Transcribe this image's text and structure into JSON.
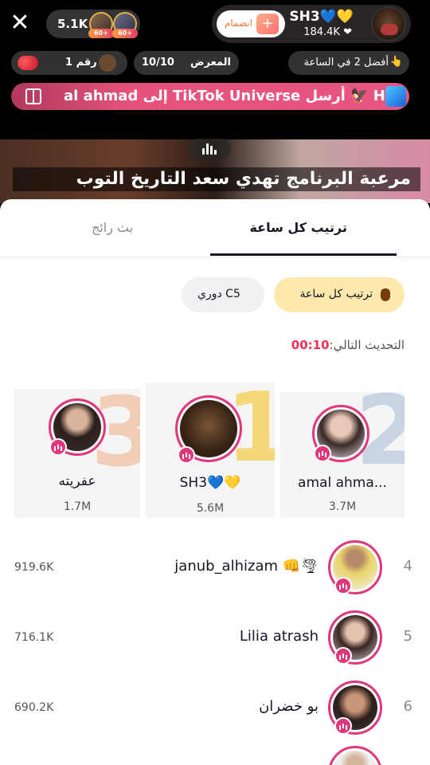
{
  "header": {
    "viewers": "5.1K",
    "viewer_badges": [
      "60+",
      "60+"
    ],
    "join_label": "انضمام",
    "host_name": "SH3💙💛",
    "host_likes": "184.4K ❤",
    "rank_label": "رقم 1",
    "gallery_label": "المعرض",
    "gallery_count": "10/10",
    "hourly_label": "أفضل 2 في الساعة"
  },
  "banner": {
    "text": "al ahmad إلى TikTok Universe أرسل 🦅 H"
  },
  "video": {
    "caption": "مرعبة البرنامج تهدي سعد التاريخ التوب"
  },
  "sheet": {
    "tabs": [
      {
        "label": "ترتيب كل ساعة",
        "active": true
      },
      {
        "label": "بث رائج",
        "active": false
      }
    ],
    "chips": [
      {
        "label": "ترتيب كل ساعة",
        "active": true
      },
      {
        "label": "دوري C5",
        "active": false
      }
    ],
    "next_update_label": "التحديث التالي:",
    "next_update_timer": "00:10",
    "podium": [
      {
        "rank": "2",
        "name": "amal ahma...",
        "score": "3.7M"
      },
      {
        "rank": "1",
        "name": "SH3💙💛",
        "score": "5.6M"
      },
      {
        "rank": "3",
        "name": "عفريته",
        "score": "1.7M"
      }
    ],
    "list": [
      {
        "rank": "4",
        "name": "janub_alhizam 👊🌪",
        "score": "919.6K"
      },
      {
        "rank": "5",
        "name": "Lilia atrash",
        "score": "716.1K"
      },
      {
        "rank": "6",
        "name": "بو خضران",
        "score": "690.2K"
      }
    ]
  },
  "colors": {
    "accent": "#fe2c55",
    "live_ring": "#e2367b",
    "chip_active": "#fde9ad",
    "banner": "#e5527a"
  }
}
